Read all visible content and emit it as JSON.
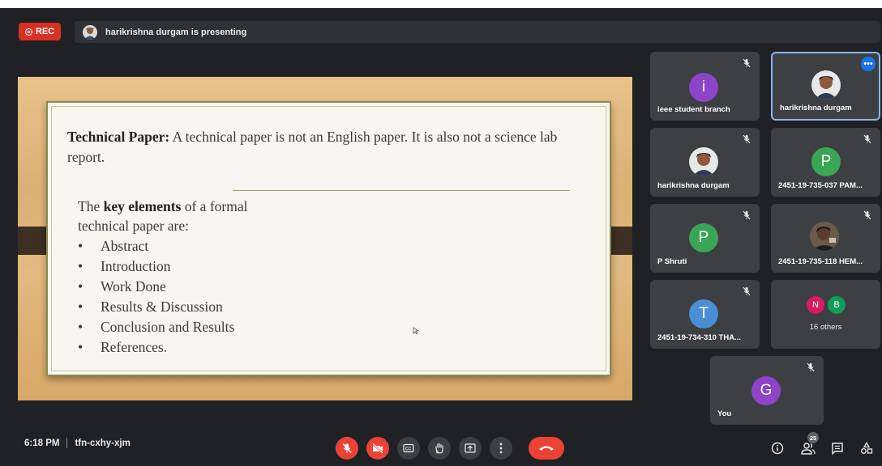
{
  "recording": {
    "label": "REC"
  },
  "presenting": {
    "text": "harikrishna durgam is presenting"
  },
  "slide": {
    "heading": "Technical Paper:",
    "paragraph": " A technical paper is not an English paper. It is also not a science lab report.",
    "key_intro_pre": "The ",
    "key_intro_bold": "key elements",
    "key_intro_post": " of a formal technical paper are:",
    "bullets": [
      "Abstract",
      "Introduction",
      "Work Done",
      "Results & Discussion",
      "Conclusion and Results",
      "References."
    ]
  },
  "participants": [
    {
      "name": "ieee student branch",
      "avatar": "i",
      "color": "#8e44c9",
      "muted": true
    },
    {
      "name": "harikrishna durgam",
      "avatar": "photo",
      "muted": false,
      "active": true
    },
    {
      "name": "harikrishna durgam",
      "avatar": "photo",
      "muted": true
    },
    {
      "name": "2451-19-735-037 PAM...",
      "avatar": "P",
      "color": "#3aa655",
      "muted": true
    },
    {
      "name": "P Shruti",
      "avatar": "P",
      "color": "#3aa655",
      "muted": true
    },
    {
      "name": "2451-19-735-118 HEM...",
      "avatar": "photo",
      "muted": true
    },
    {
      "name": "2451-19-734-310 THA...",
      "avatar": "T",
      "color": "#4a8fd6",
      "muted": true
    },
    {
      "name": "You",
      "avatar": "G",
      "color": "#8e44c9",
      "muted": true
    }
  ],
  "others": {
    "label": "16 others",
    "avatars": [
      "N",
      "B"
    ],
    "colors": [
      "#d81b60",
      "#0f9d58"
    ]
  },
  "bottom": {
    "time": "6:18 PM",
    "meeting_code": "tfn-cxhy-xjm",
    "participant_count": "25"
  },
  "icons": {
    "record": "record-icon",
    "mic": "mic-off-icon",
    "camera": "camera-off-icon",
    "captions": "captions-icon",
    "hand": "raise-hand-icon",
    "present": "present-screen-icon",
    "more": "more-options-icon",
    "hangup": "hang-up-icon",
    "info": "info-icon",
    "people": "people-icon",
    "chat": "chat-icon",
    "activities": "activities-icon"
  }
}
